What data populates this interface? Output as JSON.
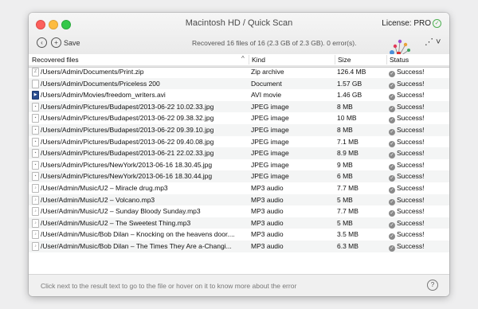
{
  "window": {
    "title": "Macintosh HD / Quick Scan",
    "license_label": "License: PRO"
  },
  "toolbar": {
    "save_label": "Save",
    "status": "Recovered 16 files of 16 (2.3 GB of 2.3 GB). 0 error(s)."
  },
  "table": {
    "columns": [
      "Recovered files",
      "Kind",
      "Size",
      "Status"
    ],
    "rows": [
      {
        "path": "/Users/Admin/Documents/Print.zip",
        "kind": "Zip archive",
        "size": "126.4 MB",
        "status": "Success!",
        "icon": "zip"
      },
      {
        "path": "/Users/Admin/Documents/Priceless 200",
        "kind": "Document",
        "size": "1.57 GB",
        "status": "Success!",
        "icon": "doc"
      },
      {
        "path": "/Users/Admin/Movies/freedom_writers.avi",
        "kind": "AVI movie",
        "size": "1.46 GB",
        "status": "Success!",
        "icon": "avi"
      },
      {
        "path": "/Users/Admin/Pictures/Budapest/2013-06-22 10.02.33.jpg",
        "kind": "JPEG image",
        "size": "8 MB",
        "status": "Success!",
        "icon": "jpg"
      },
      {
        "path": "/Users/Admin/Pictures/Budapest/2013-06-22 09.38.32.jpg",
        "kind": "JPEG image",
        "size": "10 MB",
        "status": "Success!",
        "icon": "jpg"
      },
      {
        "path": "/Users/Admin/Pictures/Budapest/2013-06-22 09.39.10.jpg",
        "kind": "JPEG image",
        "size": "8 MB",
        "status": "Success!",
        "icon": "jpg"
      },
      {
        "path": "/Users/Admin/Pictures/Budapest/2013-06-22 09.40.08.jpg",
        "kind": "JPEG image",
        "size": "7.1 MB",
        "status": "Success!",
        "icon": "jpg"
      },
      {
        "path": "/Users/Admin/Pictures/Budapest/2013-06-21 22.02.33.jpg",
        "kind": "JPEG image",
        "size": "8.9 MB",
        "status": "Success!",
        "icon": "jpg"
      },
      {
        "path": "/Users/Admin/Pictures/NewYork/2013-06-16 18.30.45.jpg",
        "kind": "JPEG image",
        "size": "9 MB",
        "status": "Success!",
        "icon": "jpg"
      },
      {
        "path": "/Users/Admin/Pictures/NewYork/2013-06-16 18.30.44.jpg",
        "kind": "JPEG image",
        "size": "6 MB",
        "status": "Success!",
        "icon": "jpg"
      },
      {
        "path": "/User/Admin/Music/U2 – Miracle drug.mp3",
        "kind": "MP3 audio",
        "size": "7.7 MB",
        "status": "Success!",
        "icon": "mp3"
      },
      {
        "path": "/User/Admin/Music/U2 – Volcano.mp3",
        "kind": "MP3 audio",
        "size": "5 MB",
        "status": "Success!",
        "icon": "mp3"
      },
      {
        "path": "/User/Admin/Music/U2 – Sunday Bloody Sunday.mp3",
        "kind": "MP3 audio",
        "size": "7.7 MB",
        "status": "Success!",
        "icon": "mp3"
      },
      {
        "path": "/User/Admin/Music/U2 – The Sweetest Thing.mp3",
        "kind": "MP3 audio",
        "size": "5 MB",
        "status": "Success!",
        "icon": "mp3"
      },
      {
        "path": "/User/Admin/Music/Bob Dilan – Knocking on the heavens door....",
        "kind": "MP3 audio",
        "size": "3.5 MB",
        "status": "Success!",
        "icon": "mp3"
      },
      {
        "path": "/User/Admin/Music/Bob Dilan – The Times They Are a-Changi...",
        "kind": "MP3 audio",
        "size": "6.3 MB",
        "status": "Success!",
        "icon": "mp3"
      }
    ]
  },
  "footer": {
    "hint": "Click next to the result text to go to the file or hover on it to know more about the error"
  },
  "colors": {
    "close": "#fc605c",
    "minimize": "#fdbc40",
    "maximize": "#34c84a",
    "alt_row": "#f4f5f5"
  }
}
